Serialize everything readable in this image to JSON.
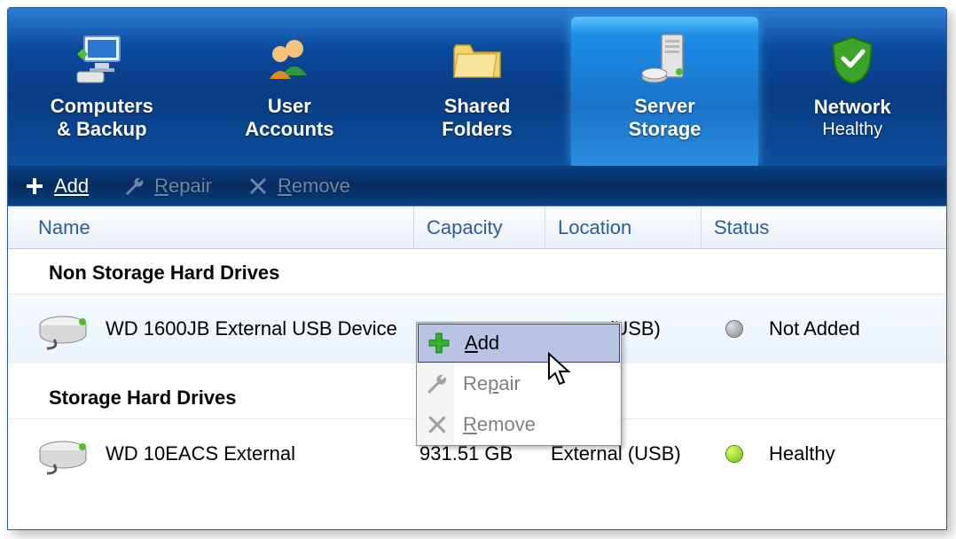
{
  "nav": {
    "tabs": [
      {
        "line1": "Computers",
        "line2": "& Backup",
        "icon": "computer-backup"
      },
      {
        "line1": "User",
        "line2": "Accounts",
        "icon": "users"
      },
      {
        "line1": "Shared",
        "line2": "Folders",
        "icon": "folder"
      },
      {
        "line1": "Server",
        "line2": "Storage",
        "icon": "server",
        "active": true
      },
      {
        "line1": "Network",
        "line2": "Healthy",
        "icon": "shield-check"
      }
    ]
  },
  "toolbar": {
    "add": "Add",
    "repair": "Repair",
    "remove": "Remove"
  },
  "columns": {
    "name": "Name",
    "capacity": "Capacity",
    "location": "Location",
    "status": "Status"
  },
  "groups": [
    {
      "title": "Non Storage Hard Drives",
      "rows": [
        {
          "name": "WD 1600JB External USB Device",
          "capacity": "",
          "location": "(USB)",
          "status": "Not Added",
          "statusColor": "gray",
          "selected": true
        }
      ]
    },
    {
      "title": "Storage Hard Drives",
      "rows": [
        {
          "name": "WD 10EACS External",
          "capacity": "931.51 GB",
          "location": "External (USB)",
          "status": "Healthy",
          "statusColor": "green",
          "selected": false
        }
      ]
    }
  ],
  "contextMenu": {
    "add": "Add",
    "repair": "Repair",
    "remove": "Remove"
  }
}
